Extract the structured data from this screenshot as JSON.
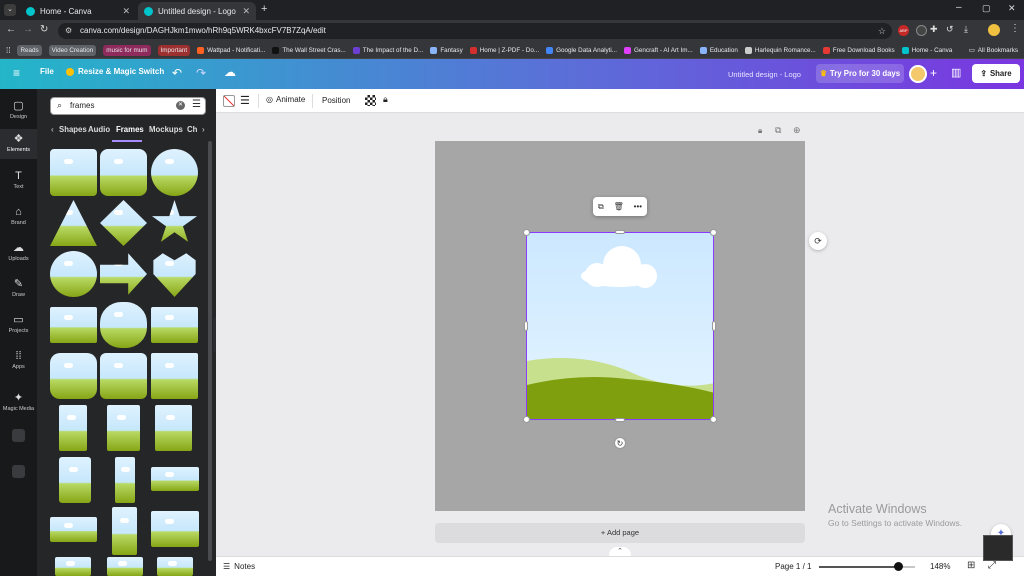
{
  "browser": {
    "tabs": [
      {
        "title": "Home - Canva",
        "active": false
      },
      {
        "title": "Untitled design - Logo",
        "active": true
      }
    ],
    "url": "canva.com/design/DAGHJkm1mwo/hRh9q5WRK4bxcFV7B7ZqA/edit",
    "bookmarks": [
      {
        "label": "Reads",
        "chip": true,
        "color": "#5f6368"
      },
      {
        "label": "Video Creation",
        "chip": true,
        "color": "#5f6368"
      },
      {
        "label": "music for mum",
        "chip": true,
        "color": "#8e2a5c"
      },
      {
        "label": "Important",
        "chip": true,
        "color": "#9c2f2f"
      },
      {
        "label": "Wattpad - Notificati...",
        "chip": false,
        "color": "#ff6122"
      },
      {
        "label": "The Wall Street Cras...",
        "chip": false,
        "color": "#111111"
      },
      {
        "label": "The Impact of the D...",
        "chip": false,
        "color": "#6a3fd1"
      },
      {
        "label": "Fantasy",
        "chip": false,
        "color": "#8ab4f8"
      },
      {
        "label": "Home | Z-PDF - Do...",
        "chip": false,
        "color": "#d32f2f"
      },
      {
        "label": "Google Data Analyti...",
        "chip": false,
        "color": "#4285f4"
      },
      {
        "label": "Gencraft - AI Art Im...",
        "chip": false,
        "color": "#e040fb"
      },
      {
        "label": "Education",
        "chip": false,
        "color": "#8ab4f8"
      },
      {
        "label": "Harlequin Romance...",
        "chip": false,
        "color": "#cccccc"
      },
      {
        "label": "Free Download Books",
        "chip": false,
        "color": "#e53935"
      },
      {
        "label": "Home - Canva",
        "chip": false,
        "color": "#00c4cc"
      }
    ],
    "all_bookmarks": "All Bookmarks"
  },
  "header": {
    "file": "File",
    "resize": "Resize & Magic Switch",
    "design_title": "Untitled design - Logo",
    "try_pro": "Try Pro for 30 days",
    "share": "Share"
  },
  "rail": [
    {
      "label": "Design",
      "icon": "▢",
      "active": false
    },
    {
      "label": "Elements",
      "icon": "❖",
      "active": true
    },
    {
      "label": "Text",
      "icon": "T",
      "active": false
    },
    {
      "label": "Brand",
      "icon": "⌂",
      "active": false
    },
    {
      "label": "Uploads",
      "icon": "☁",
      "active": false
    },
    {
      "label": "Draw",
      "icon": "✎",
      "active": false
    },
    {
      "label": "Projects",
      "icon": "▭",
      "active": false
    },
    {
      "label": "Apps",
      "icon": "⁞⁞",
      "active": false
    },
    {
      "label": "Magic Media",
      "icon": "✦",
      "active": false
    }
  ],
  "panel": {
    "search_value": "frames",
    "tabs": [
      {
        "label": "Shapes",
        "active": false
      },
      {
        "label": "Audio",
        "active": false
      },
      {
        "label": "Frames",
        "active": true
      },
      {
        "label": "Mockups",
        "active": false
      },
      {
        "label": "Ch",
        "active": false
      }
    ]
  },
  "toolbar": {
    "animate": "Animate",
    "position": "Position"
  },
  "canvas": {
    "add_page": "+ Add page"
  },
  "watermark": {
    "title": "Activate Windows",
    "subtitle": "Go to Settings to activate Windows."
  },
  "status": {
    "notes": "Notes",
    "page": "Page 1 / 1",
    "zoom": "148%",
    "zoom_fraction": 0.82
  }
}
